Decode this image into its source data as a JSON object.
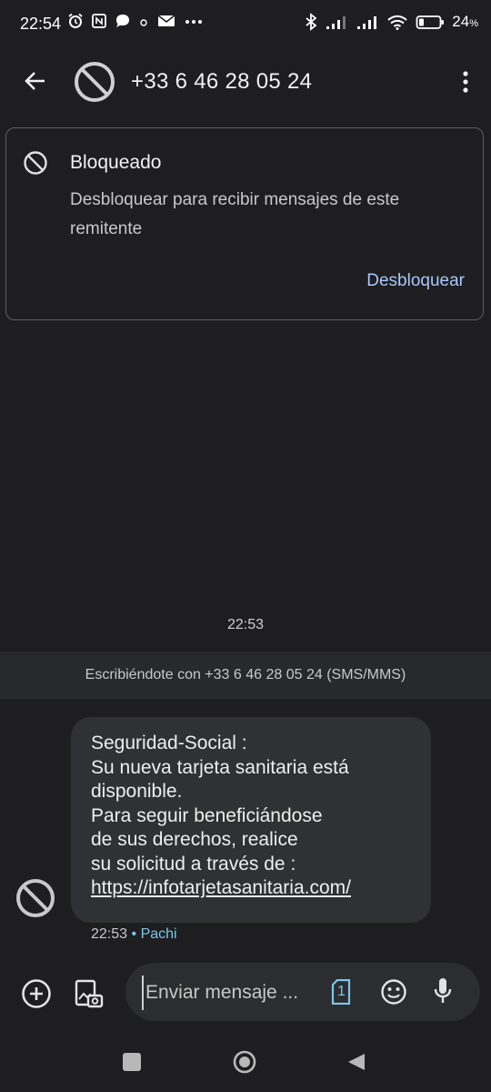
{
  "status_bar": {
    "time": "22:54",
    "battery": "24",
    "battery_unit": "%",
    "battery_level_percent": 24,
    "icons_left": [
      "alarm-icon",
      "nfc-icon",
      "chat-bubble-icon",
      "dot-icon",
      "mail-icon",
      "more-dots-icon"
    ],
    "icons_right": [
      "bluetooth-icon",
      "signal-icon",
      "signal-icon",
      "wifi-icon",
      "battery-icon"
    ]
  },
  "header": {
    "title": "+33 6 46 28 05 24",
    "back_icon": "arrow-back-icon",
    "avatar_icon": "blocked-icon",
    "menu_icon": "more-vert-icon"
  },
  "blocked_banner": {
    "title": "Bloqueado",
    "description": "Desbloquear para recibir mensajes de este remitente",
    "action": "Desbloquear"
  },
  "conversation": {
    "timestamp": "22:53",
    "sending_info": "Escribiéndote con +33 6 46 28 05 24 (SMS/MMS)",
    "message": {
      "lines": [
        "Seguridad-Social :",
        "Su nueva tarjeta sanitaria está",
        "disponible.",
        "Para seguir beneficiándose",
        "de sus derechos, realice",
        "su solicitud a través de :"
      ],
      "link": "https://infotarjetasanitaria.com/",
      "time": "22:53",
      "separator": "•",
      "sim": "Pachi"
    }
  },
  "composer": {
    "placeholder": "Enviar mensaje ...",
    "sim_badge": "1",
    "icons": [
      "add-circle-icon",
      "gallery-icon",
      "sim-icon",
      "emoji-icon",
      "mic-icon"
    ]
  },
  "colors": {
    "background": "#1e1e20",
    "accent": "#a8c7fa",
    "sim_label": "#7cc7e9",
    "bubble": "#303134"
  }
}
